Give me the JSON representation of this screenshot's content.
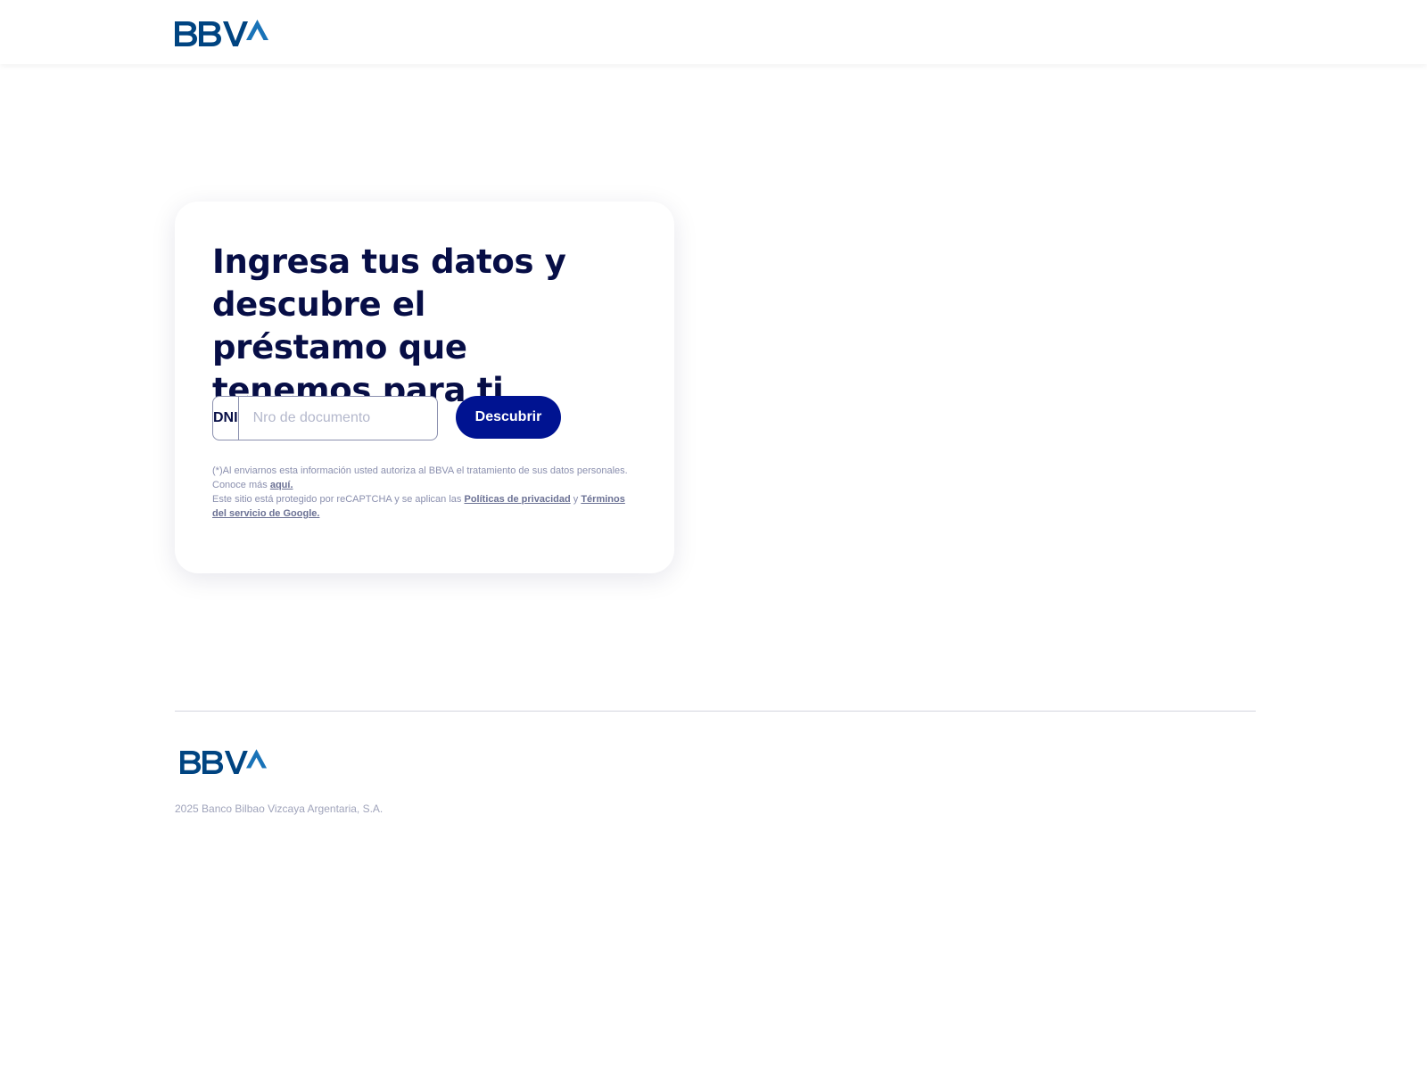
{
  "header": {
    "logo_text": "BBVA"
  },
  "brand": {
    "logo_color": "#004481",
    "primary_color": "#001391",
    "title_color": "#070e46"
  },
  "card": {
    "title": "Ingresa tus datos y descubre el préstamo que tenemos para ti",
    "document_type": "DNI",
    "document_placeholder": "Nro de documento",
    "document_value": "",
    "submit_label": "Descubrir",
    "legal": {
      "consent_text": "(*)Al enviarnos esta información usted autoriza al BBVA el tratamiento de sus datos personales.",
      "learn_more_text": "Conoce más",
      "learn_more_link": "aquí.",
      "recaptcha_text": "Este sitio está protegido por reCAPTCHA y se aplican las",
      "privacy_link": "Políticas de privacidad",
      "and_text": "y",
      "terms_link": "Términos del servicio de Google."
    }
  },
  "footer": {
    "logo_text": "BBVA",
    "copyright": "2025 Banco Bilbao Vizcaya Argentaria, S.A."
  }
}
